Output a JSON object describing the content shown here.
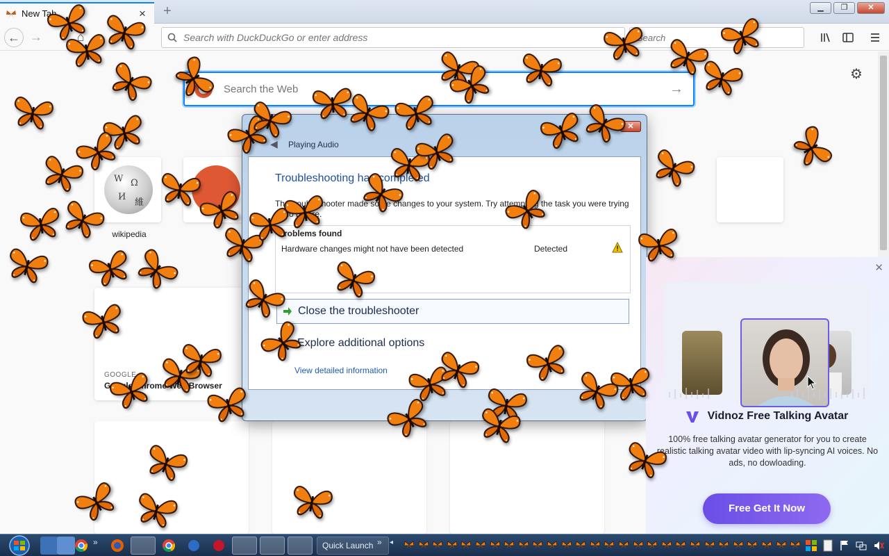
{
  "browser": {
    "tab_title": "New Tab",
    "url_placeholder": "Search with DuckDuckGo or enter address",
    "search_placeholder": "Search"
  },
  "newtab": {
    "web_search_placeholder": "Search the Web",
    "top_sites": [
      {
        "label": "wikipedia"
      }
    ],
    "highlight": {
      "source": "GOOGLE",
      "title": "Google Chrome Web Browser"
    }
  },
  "dialog": {
    "breadcrumb": "Playing Audio",
    "heading": "Troubleshooting has completed",
    "description": "The troubleshooter made some changes to your system. Try attempting the task you were trying to do before.",
    "problems_header": "Problems found",
    "problem_text": "Hardware changes might not have been detected",
    "problem_status": "Detected",
    "action_close": "Close the troubleshooter",
    "action_explore": "Explore additional options",
    "link": "View detailed information",
    "close_glyph": "✕"
  },
  "ad": {
    "title": "Vidnoz Free Talking Avatar",
    "description": "100% free talking avatar generator for you to create realistic talking avatar video with lip-syncing AI voices. No ads, no dowloading.",
    "cta": "Free Get It Now",
    "brand_color": "#6a4ee6"
  },
  "taskbar": {
    "quick_launch_label": "Quick Launch"
  }
}
